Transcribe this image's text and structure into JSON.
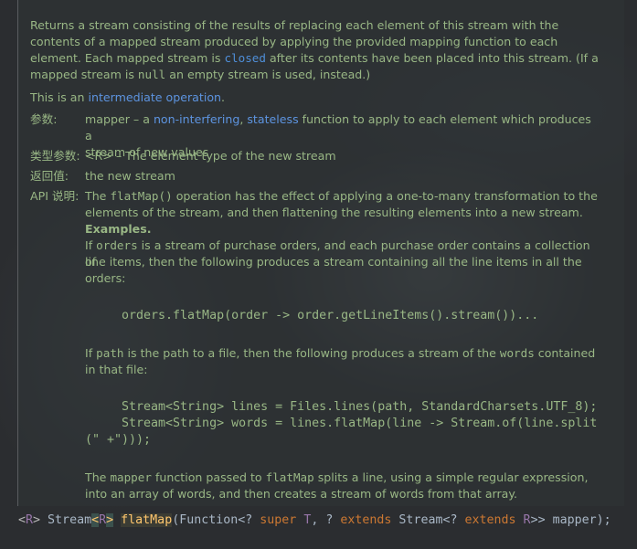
{
  "description": {
    "l1": "Returns a stream consisting of the results of replacing each element of this stream with the",
    "l2": "contents of a mapped stream produced by applying the provided mapping function to each",
    "l3a": "element. Each mapped stream is ",
    "l3_code": "closed",
    "l3b": " after its contents have been placed into this stream. (If a",
    "l4a": "mapped stream is ",
    "l4_code": "null",
    "l4b": " an empty stream is used, instead.)"
  },
  "intermediate": {
    "prefix": "This is an ",
    "link": "intermediate operation",
    "suffix": "."
  },
  "params": {
    "label": "参数:",
    "name": "mapper",
    "dash": " – a ",
    "link1": "non-interfering",
    "comma": ", ",
    "link2": "stateless",
    "rest1": " function to apply to each element which produces a",
    "rest2": "stream of new values"
  },
  "type_params": {
    "label": "类型参数:",
    "value": "<R> – The element type of the new stream"
  },
  "returns": {
    "label": "返回值:",
    "value": "the new stream"
  },
  "api_note": {
    "label": "API 说明:",
    "l1a": "The ",
    "l1_code": "flatMap()",
    "l1b": " operation has the effect of applying a one-to-many transformation to the",
    "l2": "elements of the stream, and then flattening the resulting elements into a new stream.",
    "examples": "Examples.",
    "e1a": "If ",
    "e1_code": "orders",
    "e1b": " is a stream of purchase orders, and each purchase order contains a collection of",
    "e2": "line items, then the following produces a stream containing all the line items in all the",
    "e3": "orders:",
    "code1": "orders.flatMap(order -> order.getLineItems().stream())...",
    "f1a": "If ",
    "f1_code": "path",
    "f1b": " is the path to a file, then the following produces a stream of the ",
    "f1_code2": "words",
    "f1c": " contained",
    "f2": "in that file:",
    "code2_l1": "Stream<String> lines = Files.lines(path, StandardCharsets.UTF_8);",
    "code2_l2": "Stream<String> words = lines.flatMap(line -> Stream.of(line.split",
    "code2_l3": "(\" +\")));",
    "m1a": "The ",
    "m1_code": "mapper",
    "m1b": " function passed to ",
    "m1_code2": "flatMap",
    "m1c": " splits a line, using a simple regular expression,",
    "m2": "into an array of words, and then creates a stream of words from that array."
  },
  "signature": {
    "g_open": "<",
    "g_R": "R",
    "g_close": "> ",
    "stream": "Stream",
    "lt": "<",
    "R2": "R",
    "gt": ">",
    "sp": " ",
    "name": "flatMap",
    "p1": "(Function<? ",
    "super": "super",
    "sp2": " ",
    "T": "T",
    "p2": ", ? ",
    "extends1": "extends",
    "p3": " Stream<? ",
    "extends2": "extends",
    "sp3": " ",
    "R3": "R",
    "p4": ">> mapper);"
  }
}
